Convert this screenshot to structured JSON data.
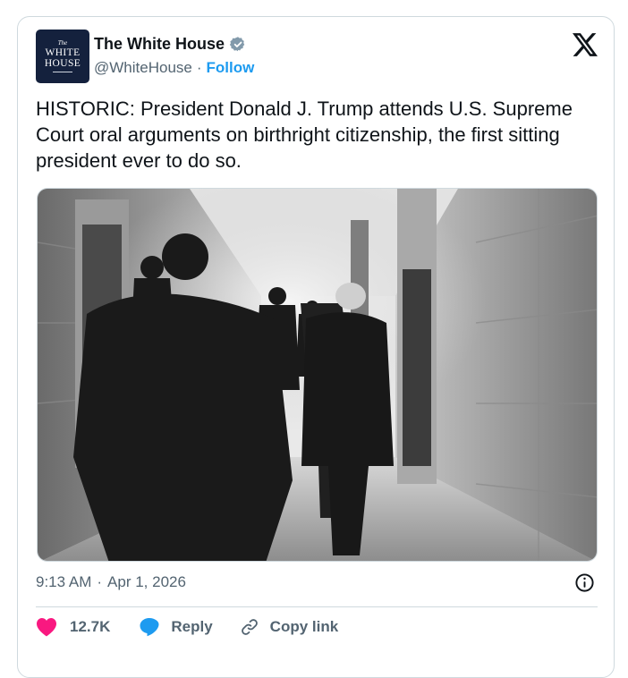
{
  "account": {
    "avatar_lines": [
      "The",
      "WHITE",
      "HOUSE"
    ],
    "name": "The White House",
    "handle": "@WhiteHouse",
    "separator": "·",
    "follow_label": "Follow",
    "verified_icon": "verified-badge-icon",
    "platform_icon": "x-logo-icon"
  },
  "tweet": {
    "text": "HISTORIC: President Donald J. Trump attends U.S. Supreme Court oral arguments on birthright citizenship, the first sitting president ever to do so.",
    "time": "9:13 AM",
    "date_separator": "·",
    "date": "Apr 1, 2026",
    "info_icon": "info-icon"
  },
  "actions": {
    "like_count": "12.7K",
    "reply_label": "Reply",
    "copy_link_label": "Copy link"
  },
  "colors": {
    "accent": "#1d9bf0",
    "like": "#f91880",
    "muted": "#536471",
    "text": "#0f1419",
    "border": "#cfd9de"
  }
}
